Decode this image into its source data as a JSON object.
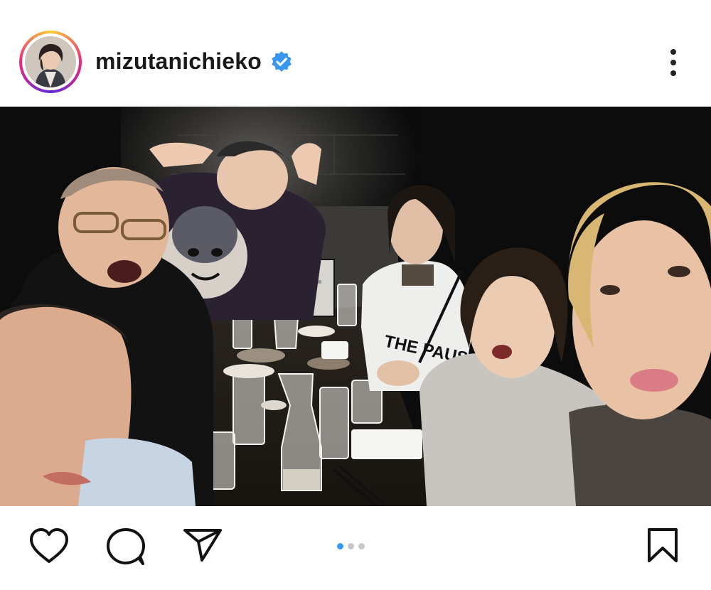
{
  "post": {
    "username": "mizutanichieko",
    "verified": true,
    "more_icon": "more-vertical-icon",
    "avatar_icon": "profile-avatar"
  },
  "carousel": {
    "slide_count": 3,
    "active_index": 0,
    "active_color": "#3897f0",
    "inactive_color": "#c7c7c7"
  },
  "actions": {
    "like_icon": "heart-icon",
    "comment_icon": "comment-icon",
    "share_icon": "send-icon",
    "save_icon": "bookmark-icon"
  },
  "colors": {
    "verified_badge": "#3897f0",
    "text": "#1a1a1a",
    "photo_background": "#0b0b0b"
  }
}
